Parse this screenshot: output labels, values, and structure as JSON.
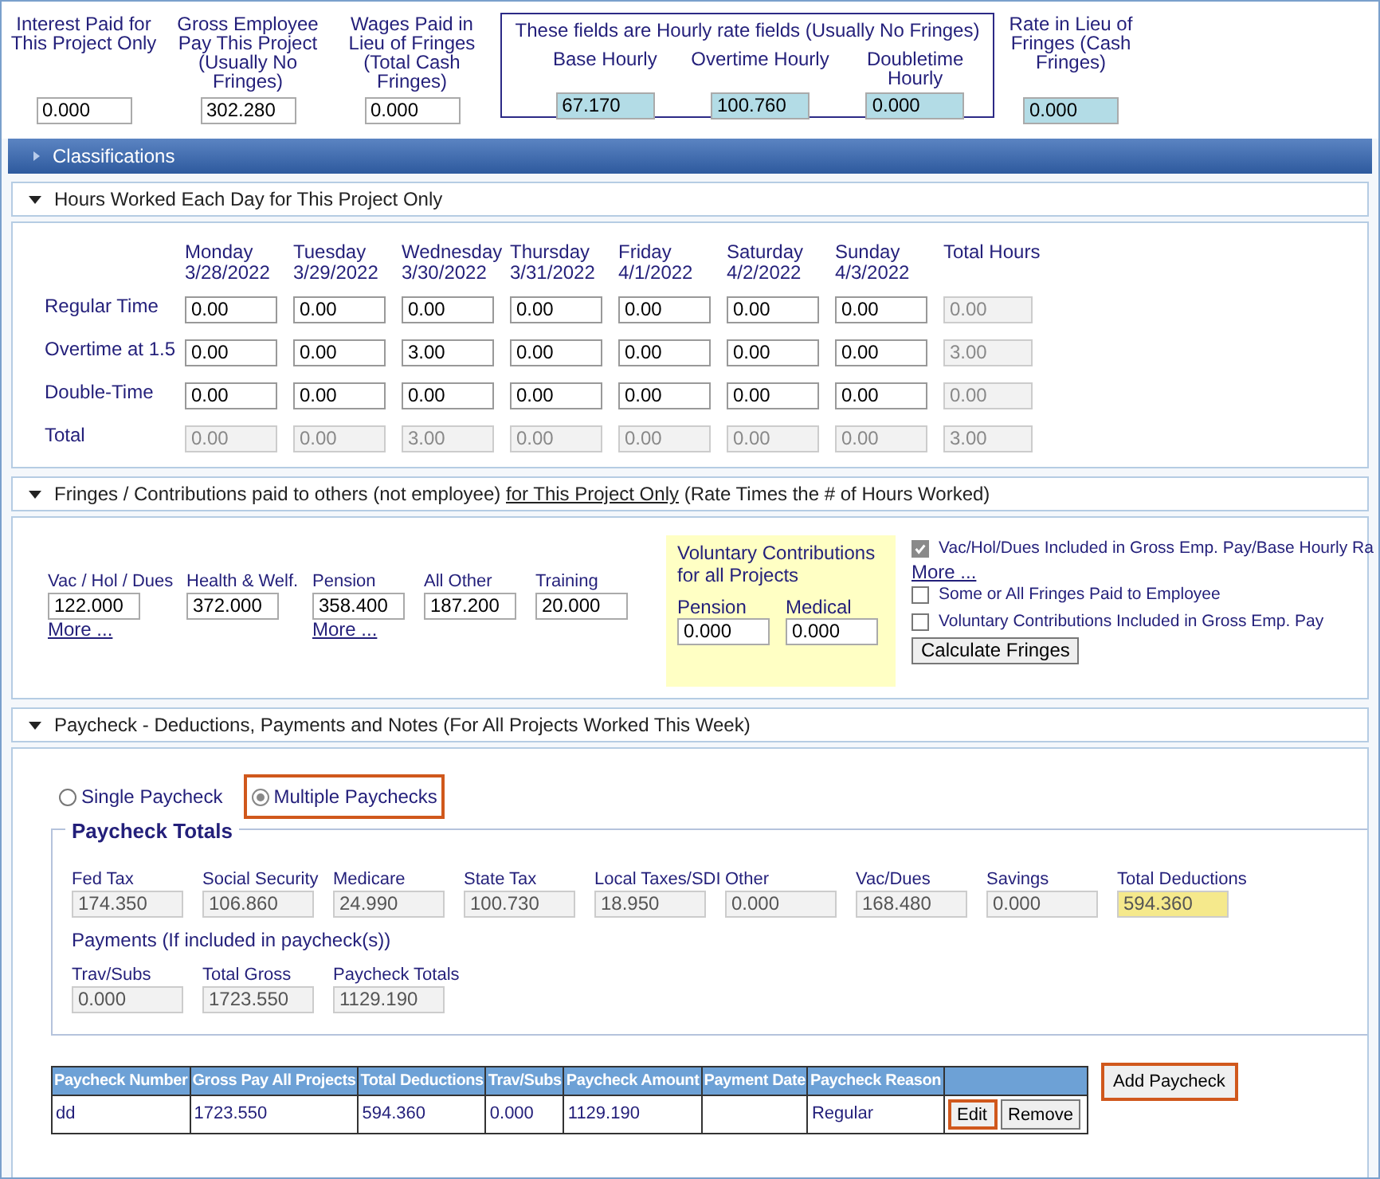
{
  "rates": {
    "fields": [
      {
        "label": "Interest Paid for This Project Only",
        "value": "0.000",
        "kind": "plain"
      },
      {
        "label": "Gross Employee Pay This Project (Usually No Fringes)",
        "value": "302.280",
        "kind": "plain"
      },
      {
        "label": "Wages Paid in Lieu of Fringes (Total Cash Fringes)",
        "value": "0.000",
        "kind": "plain"
      }
    ],
    "hourly_group": {
      "title": "These fields are Hourly rate fields (Usually No Fringes)",
      "fields": [
        {
          "label": "Base Hourly",
          "value": "67.170"
        },
        {
          "label": "Overtime Hourly",
          "value": "100.760"
        },
        {
          "label": "Doubletime Hourly",
          "value": "0.000"
        }
      ]
    },
    "cash_rate": {
      "label": "Rate in Lieu of Fringes (Cash Fringes)",
      "value": "0.000"
    }
  },
  "classifications": {
    "title": "Classifications",
    "expanded": false
  },
  "hours": {
    "title": "Hours Worked Each Day for This Project Only",
    "expanded": true,
    "days": [
      {
        "day": "Monday",
        "date": "3/28/2022"
      },
      {
        "day": "Tuesday",
        "date": "3/29/2022"
      },
      {
        "day": "Wednesday",
        "date": "3/30/2022"
      },
      {
        "day": "Thursday",
        "date": "3/31/2022"
      },
      {
        "day": "Friday",
        "date": "4/1/2022"
      },
      {
        "day": "Saturday",
        "date": "4/2/2022"
      },
      {
        "day": "Sunday",
        "date": "4/3/2022"
      }
    ],
    "total_header": "Total Hours",
    "rows": [
      {
        "label": "Regular Time",
        "kind": "input",
        "values": [
          "0.00",
          "0.00",
          "0.00",
          "0.00",
          "0.00",
          "0.00",
          "0.00"
        ],
        "total": "0.00"
      },
      {
        "label": "Overtime at 1.5",
        "kind": "input",
        "values": [
          "0.00",
          "0.00",
          "3.00",
          "0.00",
          "0.00",
          "0.00",
          "0.00"
        ],
        "total": "3.00"
      },
      {
        "label": "Double-Time",
        "kind": "input",
        "values": [
          "0.00",
          "0.00",
          "0.00",
          "0.00",
          "0.00",
          "0.00",
          "0.00"
        ],
        "total": "0.00"
      },
      {
        "label": "Total",
        "kind": "readonly",
        "values": [
          "0.00",
          "0.00",
          "3.00",
          "0.00",
          "0.00",
          "0.00",
          "0.00"
        ],
        "total": "3.00"
      }
    ]
  },
  "fringes": {
    "title_before": "Fringes / Contributions paid to others (not employee)",
    "title_link": "for This Project Only",
    "title_after": "(Rate Times the # of Hours Worked)",
    "expanded": true,
    "fields": [
      {
        "label": "Vac / Hol / Dues",
        "value": "122.000",
        "more": "More ..."
      },
      {
        "label": "Health & Welf.",
        "value": "372.000"
      },
      {
        "label": "Pension",
        "value": "358.400",
        "more": "More ..."
      },
      {
        "label": "All Other",
        "value": "187.200"
      },
      {
        "label": "Training",
        "value": "20.000"
      }
    ],
    "voluntary": {
      "title": "Voluntary Contributions for all Projects",
      "fields": [
        {
          "label": "Pension",
          "value": "0.000"
        },
        {
          "label": "Medical",
          "value": "0.000"
        }
      ]
    },
    "options": [
      {
        "label": "Vac/Hol/Dues Included in Gross Emp. Pay/Base Hourly Ra",
        "checked": true,
        "more": "More ..."
      },
      {
        "label": "Some or All Fringes Paid to Employee",
        "checked": false
      },
      {
        "label": "Voluntary Contributions Included in Gross Emp. Pay",
        "checked": false
      }
    ],
    "button": "Calculate Fringes"
  },
  "paycheck": {
    "title": "Paycheck - Deductions, Payments and Notes (For All Projects Worked This Week)",
    "expanded": true,
    "modes": [
      {
        "label": "Single Paycheck",
        "selected": false,
        "highlighted": false
      },
      {
        "label": "Multiple Paychecks",
        "selected": true,
        "highlighted": true
      }
    ],
    "totals_title": "Paycheck Totals",
    "deductions": [
      {
        "label": "Fed Tax",
        "value": "174.350",
        "highlighted": false
      },
      {
        "label": "Social Security",
        "value": "106.860",
        "highlighted": false
      },
      {
        "label": "Medicare",
        "value": "24.990",
        "highlighted": false
      },
      {
        "label": "State Tax",
        "value": "100.730",
        "highlighted": false
      },
      {
        "label": "Local Taxes/SDI",
        "value": "18.950",
        "highlighted": false
      },
      {
        "label": "Other",
        "value": "0.000",
        "highlighted": false
      },
      {
        "label": "Vac/Dues",
        "value": "168.480",
        "highlighted": false
      },
      {
        "label": "Savings",
        "value": "0.000",
        "highlighted": false
      },
      {
        "label": "Total Deductions",
        "value": "594.360",
        "highlighted": true
      }
    ],
    "payments_label": "Payments (If included in paycheck(s))",
    "payments": [
      {
        "label": "Trav/Subs",
        "value": "0.000"
      },
      {
        "label": "Total Gross",
        "value": "1723.550"
      },
      {
        "label": "Paycheck Totals",
        "value": "1129.190"
      }
    ],
    "table": {
      "columns": [
        "Paycheck Number",
        "Gross Pay All Projects",
        "Total Deductions",
        "Trav/Subs",
        "Paycheck Amount",
        "Payment Date",
        "Paycheck Reason"
      ],
      "rows": [
        {
          "cells": [
            "dd",
            "1723.550",
            "594.360",
            "0.000",
            "1129.190",
            "",
            "Regular"
          ],
          "actions": [
            {
              "label": "Edit",
              "highlighted": true
            },
            {
              "label": "Remove",
              "highlighted": false
            }
          ]
        }
      ]
    },
    "add_button": {
      "label": "Add Paycheck",
      "highlighted": true
    }
  }
}
